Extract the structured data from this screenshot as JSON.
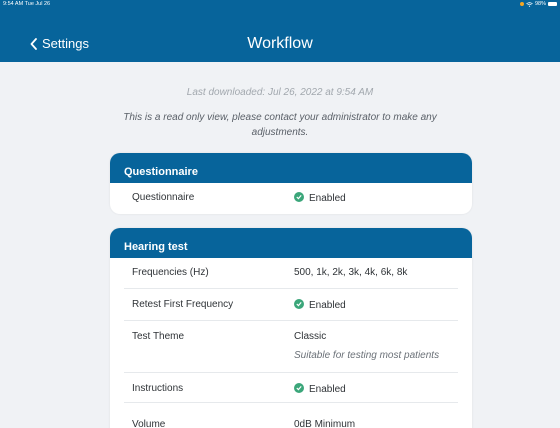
{
  "status_bar": {
    "time": "9:54 AM  Tue Jul 26",
    "battery": "98%"
  },
  "header": {
    "back_label": "Settings",
    "title": "Workflow"
  },
  "notice": {
    "last_downloaded": "Last downloaded: Jul 26, 2022 at 9:54 AM",
    "read_only": "This is a read only view, please contact your administrator to make any adjustments."
  },
  "questionnaire": {
    "title": "Questionnaire",
    "rows": [
      {
        "label": "Questionnaire",
        "value": "Enabled"
      }
    ]
  },
  "hearing_test": {
    "title": "Hearing test",
    "rows": [
      {
        "label": "Frequencies (Hz)",
        "value": "500, 1k, 2k, 3k, 4k, 6k, 8k"
      },
      {
        "label": "Retest First Frequency",
        "value": "Enabled"
      },
      {
        "label": "Test Theme",
        "value": "Classic",
        "sub": "Suitable for testing most patients"
      },
      {
        "label": "Instructions",
        "value": "Enabled"
      },
      {
        "label": "Volume",
        "value": "0dB Minimum"
      }
    ]
  },
  "colors": {
    "brand": "#07649b",
    "enabled": "#3ba67a"
  }
}
